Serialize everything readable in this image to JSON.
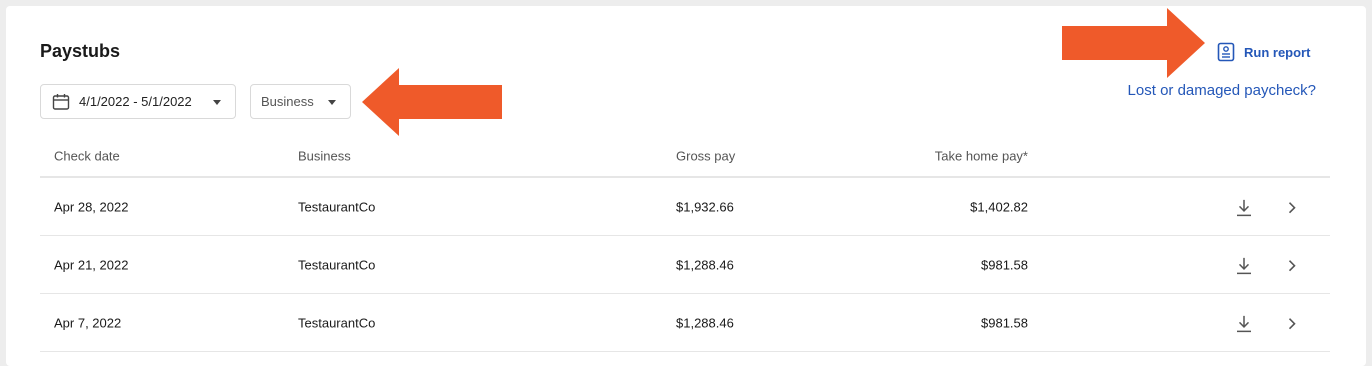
{
  "page": {
    "title": "Paystubs"
  },
  "filters": {
    "date_range": "4/1/2022 - 5/1/2022",
    "business": "Business"
  },
  "actions": {
    "run_report": "Run report",
    "lost_paycheck": "Lost or damaged paycheck?"
  },
  "table": {
    "headers": {
      "check_date": "Check date",
      "business": "Business",
      "gross_pay": "Gross pay",
      "take_home": "Take home pay*"
    },
    "rows": [
      {
        "check_date": "Apr 28, 2022",
        "business": "TestaurantCo",
        "gross_pay": "$1,932.66",
        "take_home": "$1,402.82"
      },
      {
        "check_date": "Apr 21, 2022",
        "business": "TestaurantCo",
        "gross_pay": "$1,288.46",
        "take_home": "$981.58"
      },
      {
        "check_date": "Apr 7, 2022",
        "business": "TestaurantCo",
        "gross_pay": "$1,288.46",
        "take_home": "$981.58"
      }
    ]
  },
  "colors": {
    "link": "#2457b8",
    "annotation_arrow": "#ef5a2a",
    "background": "#ededed"
  },
  "icons": [
    "calendar-icon",
    "caret-down-icon",
    "report-icon",
    "download-icon",
    "chevron-right-icon",
    "annotation-arrow"
  ]
}
